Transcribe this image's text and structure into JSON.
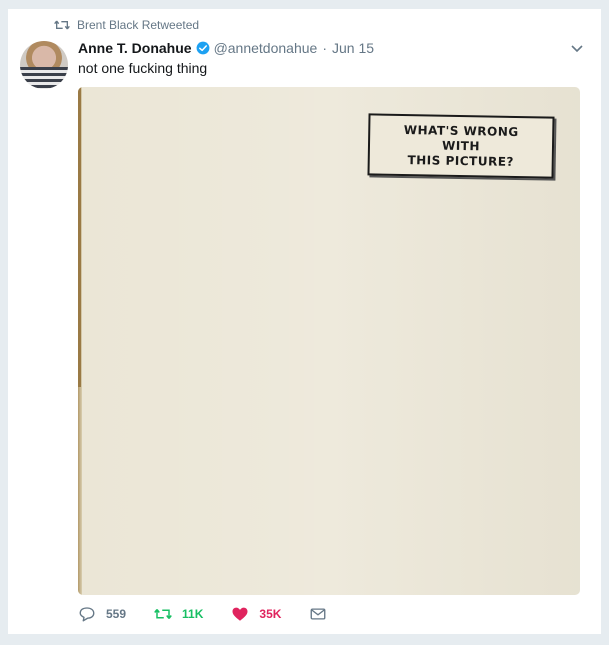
{
  "context": {
    "text": "Brent Black Retweeted"
  },
  "tweet": {
    "fullname": "Anne T. Donahue",
    "username": "@annetdonahue",
    "separator": "·",
    "time": "Jun 15",
    "text": "not one fucking thing",
    "media": {
      "caption_lines": [
        "WHAT'S WRONG",
        "WITH",
        "THIS PICTURE?"
      ]
    },
    "actions": {
      "reply_count": "559",
      "retweet_count": "11K",
      "like_count": "35K"
    }
  },
  "colors": {
    "retweet_green": "#17bf63",
    "like_red": "#e0245e",
    "verified_blue": "#1da1f2",
    "muted": "#657786"
  },
  "icons": [
    "retweet-icon",
    "verified-badge-icon",
    "caret-down-icon",
    "reply-icon",
    "heart-icon",
    "envelope-icon"
  ]
}
